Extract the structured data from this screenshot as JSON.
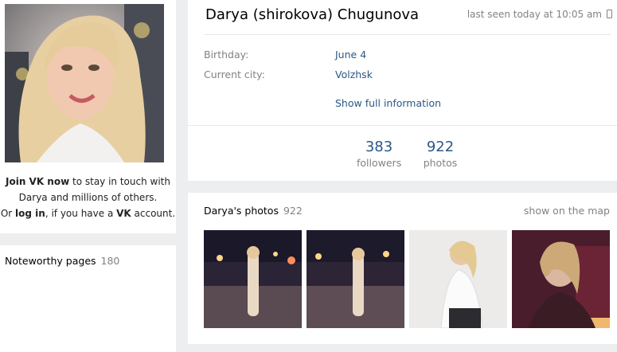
{
  "profile": {
    "name": "Darya (shirokova) Chugunova",
    "last_seen": "last seen today at 10:05 am",
    "details": [
      {
        "label": "Birthday:",
        "value": "June 4"
      },
      {
        "label": "Current city:",
        "value": "Volzhsk"
      }
    ],
    "show_full": "Show full information",
    "followers_count": "383",
    "followers_label": "followers",
    "photos_count": "922",
    "photos_label": "photos"
  },
  "join": {
    "join_now": "Join VK now",
    "line1_rest": " to stay in touch with",
    "line2": "Darya and millions of others.",
    "or": "Or ",
    "log_in": "log in",
    "line3_mid": ", if you have a ",
    "vk": "VK",
    "line3_end": " account."
  },
  "noteworthy": {
    "title": "Noteworthy pages",
    "count": "180"
  },
  "photos": {
    "title": "Darya's photos",
    "count": "922",
    "show_map": "show on the map"
  },
  "colors": {
    "background": "#edeef0",
    "link": "#2a5885",
    "muted": "#828282"
  }
}
